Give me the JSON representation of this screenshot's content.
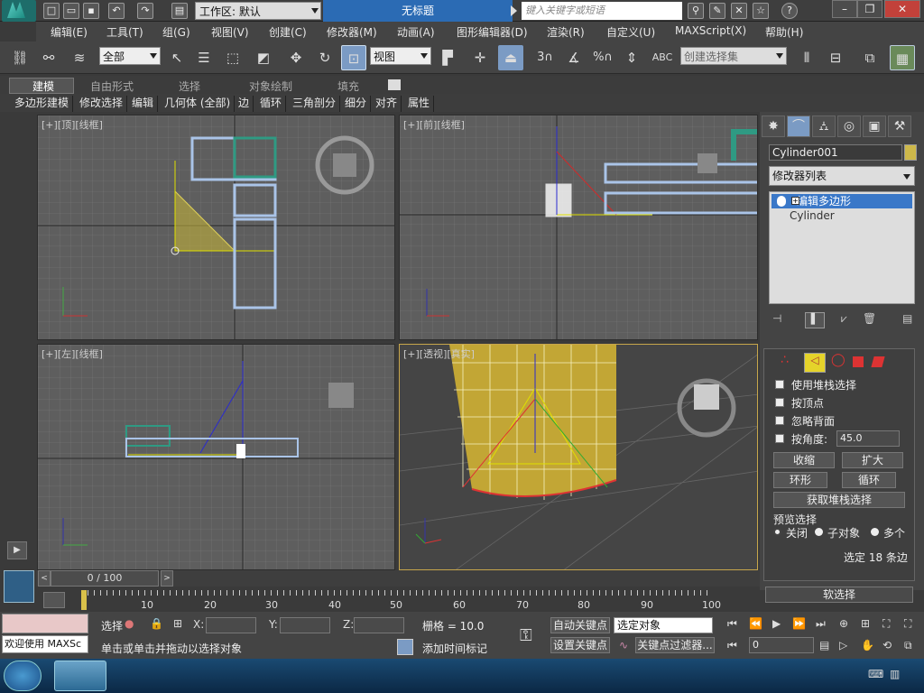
{
  "window": {
    "workspace_label": "工作区: 默认",
    "doc_title": "无标题",
    "search_placeholder": "键入关键字或短语"
  },
  "menu": [
    "编辑(E)",
    "工具(T)",
    "组(G)",
    "视图(V)",
    "创建(C)",
    "修改器(M)",
    "动画(A)",
    "图形编辑器(D)",
    "渲染(R)",
    "自定义(U)",
    "MAXScript(X)",
    "帮助(H)"
  ],
  "toolbar": {
    "filter_value": "全部",
    "ref_coord_value": "视图",
    "selection_set_placeholder": "创建选择集"
  },
  "ribbon": {
    "tabs": [
      "建模",
      "自由形式",
      "选择",
      "对象绘制",
      "填充"
    ],
    "subtabs": [
      "多边形建模",
      "修改选择",
      "编辑",
      "几何体 (全部)",
      "边",
      "循环",
      "三角剖分",
      "细分",
      "对齐",
      "属性"
    ]
  },
  "viewports": {
    "top": "[+][顶][线框]",
    "front": "[+][前][线框]",
    "left": "[+][左][线框]",
    "persp": "[+][透视][真实]"
  },
  "command_panel": {
    "object_name": "Cylinder001",
    "modifier_list": "修改器列表",
    "stack": [
      "编辑多边形",
      "Cylinder"
    ],
    "checks": [
      "使用堆栈选择",
      "按顶点",
      "忽略背面",
      "按角度:"
    ],
    "angle_value": "45.0",
    "btn_shrink": "收缩",
    "btn_grow": "扩大",
    "btn_ring": "环形",
    "btn_loop": "循环",
    "btn_get_stack": "获取堆栈选择",
    "preview_group": "预览选择",
    "preview_off": "关闭",
    "preview_sub": "子对象",
    "preview_multi": "多个",
    "selected_info": "选定 18 条边",
    "soft_sel": "软选择"
  },
  "time": {
    "slider_label": "0 / 100",
    "ticks": [
      "10",
      "20",
      "30",
      "40",
      "50",
      "60",
      "70",
      "80",
      "90",
      "100"
    ]
  },
  "status": {
    "welcome": "欢迎使用 MAXSc",
    "select_prefix": "选择",
    "x_label": "X:",
    "y_label": "Y:",
    "z_label": "Z:",
    "grid": "栅格 = 10.0",
    "prompt": "单击或单击并拖动以选择对象",
    "add_time_tag": "添加时间标记",
    "auto_key": "自动关键点",
    "set_key": "设置关键点",
    "key_mode": "选定对象",
    "key_filters": "关键点过滤器...",
    "frame": "0"
  }
}
